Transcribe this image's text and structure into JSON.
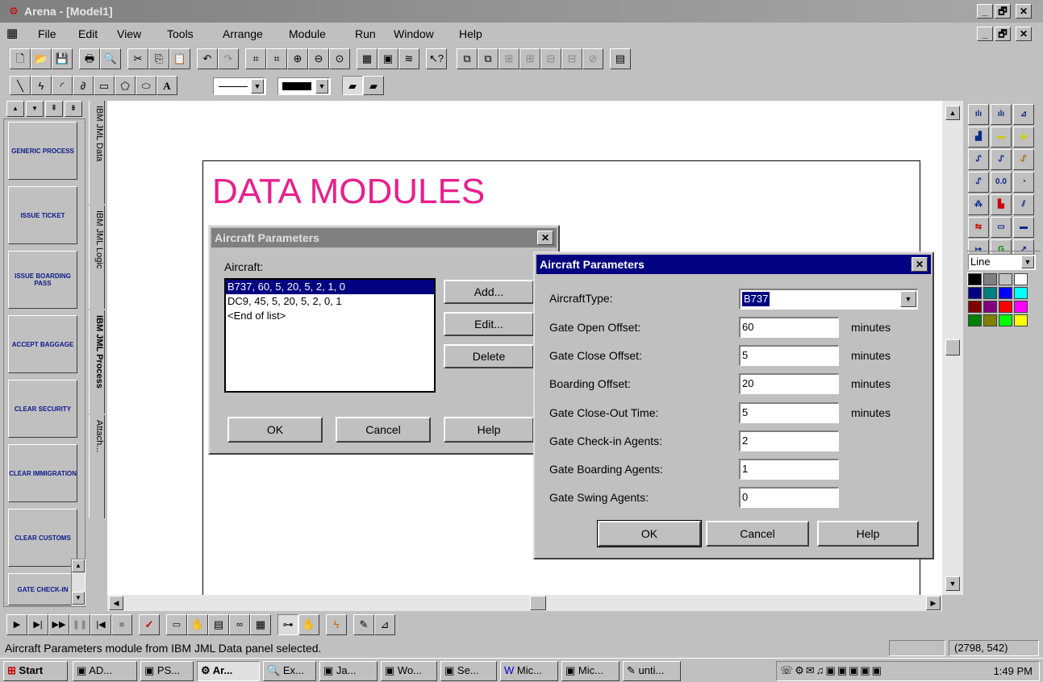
{
  "window": {
    "title": "Arena - [Model1]",
    "minimize": "_",
    "maximize": "🗗",
    "close": "✕"
  },
  "menu": [
    "File",
    "Edit",
    "View",
    "Tools",
    "Arrange",
    "Module",
    "Run",
    "Window",
    "Help"
  ],
  "palette": {
    "nav_up": "▲",
    "nav_down": "▼",
    "nav_top": "⇞",
    "nav_bottom": "⇟",
    "tiles": [
      "GENERIC PROCESS",
      "ISSUE TICKET",
      "ISSUE BOARDING PASS",
      "ACCEPT BAGGAGE",
      "CLEAR SECURITY",
      "CLEAR IMMIGRATION",
      "CLEAR CUSTOMS",
      "GATE CHECK-IN"
    ],
    "tabs": [
      "IBM JML Data",
      "IBM JML Logic",
      "IBM JML Process",
      "Attach..."
    ]
  },
  "canvas": {
    "heading": "DATA MODULES",
    "heading_color": "#e8208c"
  },
  "dialog_list": {
    "title": "Aircraft Parameters",
    "list_label": "Aircraft:",
    "items": [
      "B737, 60, 5, 20, 5, 2, 1, 0",
      "DC9, 45, 5, 20, 5, 2, 0, 1",
      "<End of list>"
    ],
    "buttons": {
      "add": "Add...",
      "edit": "Edit...",
      "delete": "Delete",
      "ok": "OK",
      "cancel": "Cancel",
      "help": "Help"
    }
  },
  "dialog_edit": {
    "title": "Aircraft Parameters",
    "aircraft_type_label": "AircraftType:",
    "aircraft_type_value": "B737",
    "fields": [
      {
        "label": "Gate Open Offset:",
        "value": "60",
        "unit": "minutes"
      },
      {
        "label": "Gate Close Offset:",
        "value": "5",
        "unit": "minutes"
      },
      {
        "label": "Boarding Offset:",
        "value": "20",
        "unit": "minutes"
      },
      {
        "label": "Gate Close-Out Time:",
        "value": "5",
        "unit": "minutes"
      },
      {
        "label": "Gate Check-in Agents:",
        "value": "2",
        "unit": ""
      },
      {
        "label": "Gate Boarding Agents:",
        "value": "1",
        "unit": ""
      },
      {
        "label": "Gate Swing Agents:",
        "value": "0",
        "unit": ""
      }
    ],
    "buttons": {
      "ok": "OK",
      "cancel": "Cancel",
      "help": "Help"
    }
  },
  "line_style": {
    "value": "Line"
  },
  "status": {
    "message": "Aircraft Parameters module from IBM JML Data panel selected.",
    "coords": "(2798, 542)"
  },
  "taskbar": {
    "start": "Start",
    "tasks": [
      "AD...",
      "PS...",
      "Ar...",
      "Ex...",
      "Ja...",
      "Wo...",
      "Se...",
      "Mic...",
      "Mic...",
      "unti..."
    ],
    "clock": "1:49 PM"
  },
  "colors": {
    "active_title": "#000080",
    "inactive_title": "#808080",
    "selection": "#000080"
  }
}
